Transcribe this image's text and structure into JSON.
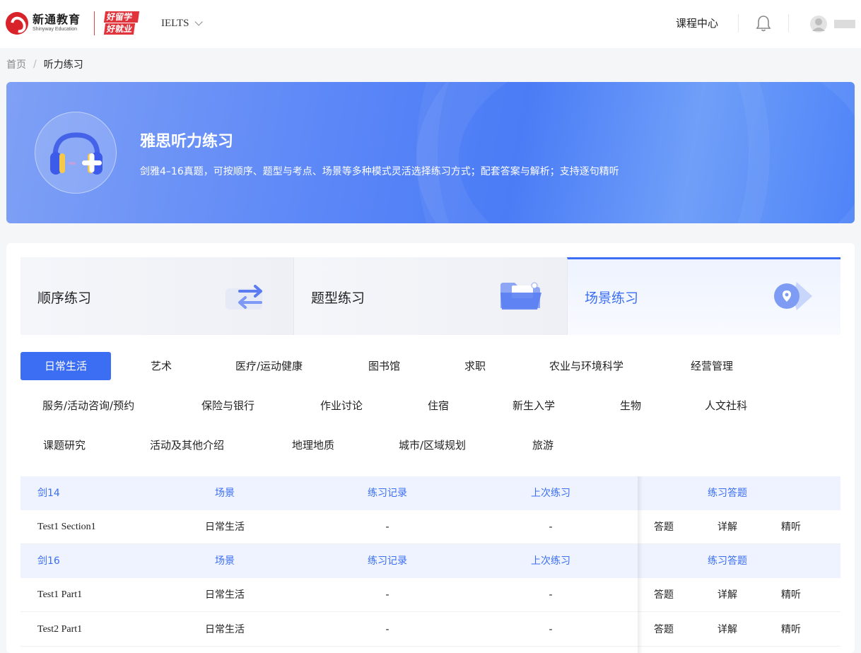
{
  "header": {
    "logo_cn": "新通教育",
    "logo_en": "Shinyway Education",
    "logo2_top": "好留学",
    "logo2_bottom": "好就业",
    "exam": "IELTS",
    "course_center": "课程中心"
  },
  "breadcrumb": {
    "home": "首页",
    "separator": "/",
    "current": "听力练习"
  },
  "banner": {
    "title": "雅思听力练习",
    "desc": "剑雅4–16真题，可按顺序、题型与考点、场景等多种模式灵活选择练习方式；配套答案与解析；支持逐句精听"
  },
  "modes": [
    {
      "label": "顺序练习",
      "icon": "arrows-swap-icon",
      "active": false
    },
    {
      "label": "题型练习",
      "icon": "folder-icon",
      "active": false
    },
    {
      "label": "场景练习",
      "icon": "location-pin-icon",
      "active": true
    }
  ],
  "tags": [
    "日常生活",
    "艺术",
    "医疗/运动健康",
    "图书馆",
    "求职",
    "农业与环境科学",
    "经营管理",
    "服务/活动咨询/预约",
    "保险与银行",
    "作业讨论",
    "住宿",
    "新生入学",
    "生物",
    "人文社科",
    "课题研究",
    "活动及其他介绍",
    "地理地质",
    "城市/区域规划",
    "旅游"
  ],
  "active_tag": "日常生活",
  "table": {
    "columns": [
      "场景",
      "练习记录",
      "上次练习",
      "练习答题"
    ],
    "actions": [
      "答题",
      "详解",
      "精听"
    ],
    "groups": [
      {
        "book": "剑14",
        "rows": [
          {
            "name": "Test1 Section1",
            "scene": "日常生活",
            "record": "-",
            "last": "-"
          }
        ]
      },
      {
        "book": "剑16",
        "rows": [
          {
            "name": "Test1 Part1",
            "scene": "日常生活",
            "record": "-",
            "last": "-"
          },
          {
            "name": "Test2 Part1",
            "scene": "日常生活",
            "record": "-",
            "last": "-"
          }
        ]
      }
    ]
  },
  "colors": {
    "primary": "#3b6ef2",
    "head_bg": "#eef3ff"
  }
}
